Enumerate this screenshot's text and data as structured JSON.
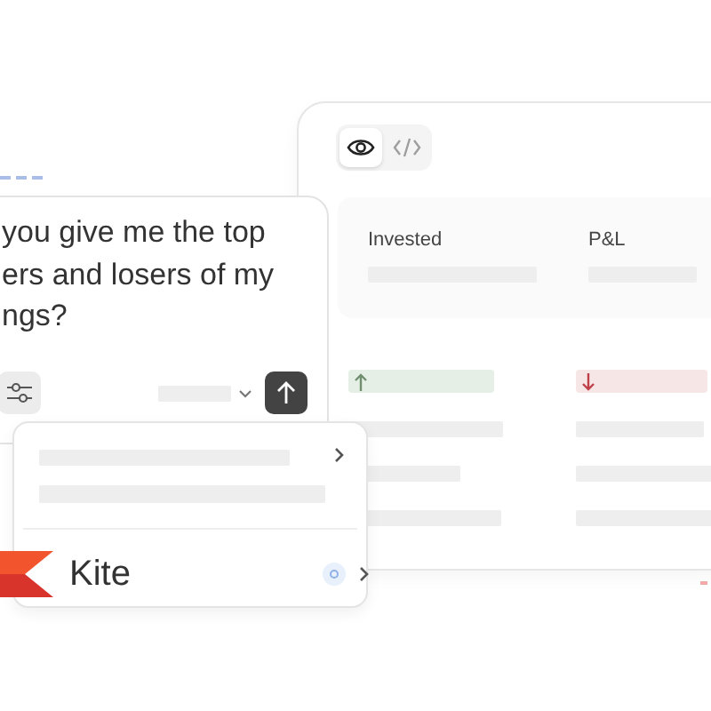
{
  "preview_panel": {
    "view_toggle": [
      {
        "kind": "eye",
        "selected": true
      },
      {
        "kind": "code",
        "selected": false
      }
    ],
    "columns": [
      {
        "header": "Invested",
        "kind": "gain"
      },
      {
        "header": "P&L",
        "kind": "loss"
      }
    ]
  },
  "chat": {
    "message_lines": [
      "you give me the top",
      "ers and losers of my",
      "ngs?"
    ]
  },
  "menu": {
    "items": [
      {
        "kind": "skeleton"
      },
      {
        "kind": "divider"
      },
      {
        "kind": "app",
        "label": "Kite"
      }
    ]
  }
}
